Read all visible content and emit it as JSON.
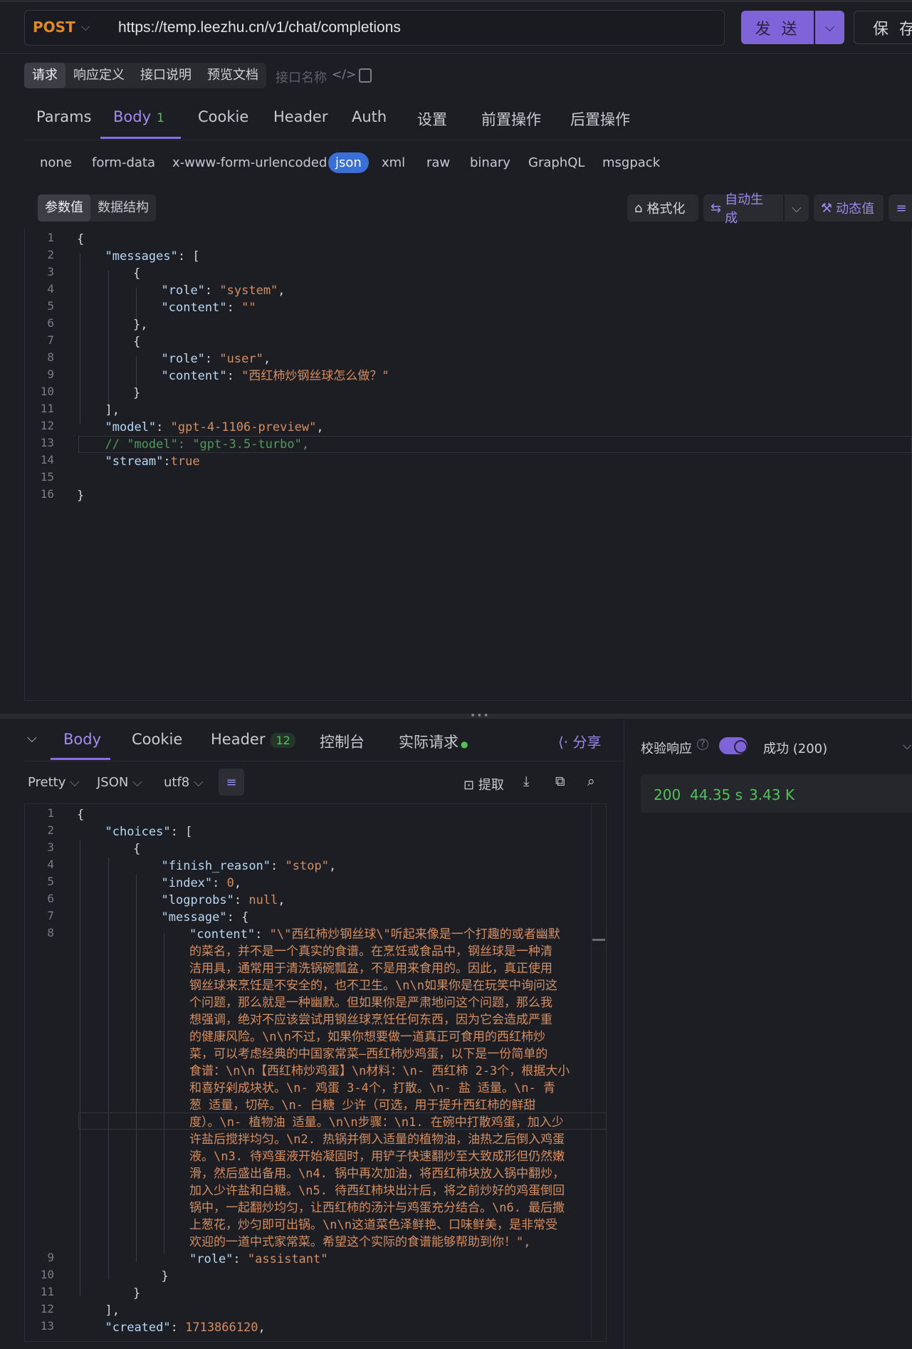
{
  "request": {
    "method": "POST",
    "url": "https://temp.leezhu.cn/v1/chat/completions",
    "send_label": "发 送",
    "save_label": "保 存"
  },
  "top_tabs": [
    "请求",
    "响应定义",
    "接口说明",
    "预览文档"
  ],
  "interface_name_placeholder": "接口名称",
  "req_tabs": {
    "params": "Params",
    "body": "Body",
    "body_count": "1",
    "cookie": "Cookie",
    "header": "Header",
    "auth": "Auth",
    "settings": "设置",
    "pre_ops": "前置操作",
    "post_ops": "后置操作"
  },
  "body_types": [
    "none",
    "form-data",
    "x-www-form-urlencoded",
    "json",
    "xml",
    "raw",
    "binary",
    "GraphQL",
    "msgpack"
  ],
  "editor_tabs": [
    "参数值",
    "数据结构"
  ],
  "editor_tools": {
    "format": "格式化",
    "auto_gen": "自动生成",
    "dynamic": "动态值"
  },
  "request_code": [
    {
      "n": "1",
      "t": "{"
    },
    {
      "n": "2",
      "t": "\"messages\": ["
    },
    {
      "n": "3",
      "t": "{"
    },
    {
      "n": "4",
      "k": "\"role\"",
      "v": "\"system\"",
      "tail": ","
    },
    {
      "n": "5",
      "k": "\"content\"",
      "v": "\"\"",
      "tail": ""
    },
    {
      "n": "6",
      "t": "},"
    },
    {
      "n": "7",
      "t": "{"
    },
    {
      "n": "8",
      "k": "\"role\"",
      "v": "\"user\"",
      "tail": ","
    },
    {
      "n": "9",
      "k": "\"content\"",
      "v": "\"西红柿炒钢丝球怎么做？\"",
      "tail": ""
    },
    {
      "n": "10",
      "t": "}"
    },
    {
      "n": "11",
      "t": "],"
    },
    {
      "n": "12",
      "k": "\"model\"",
      "v": "\"gpt-4-1106-preview\"",
      "tail": ","
    },
    {
      "n": "13",
      "comment": "// \"model\": \"gpt-3.5-turbo\","
    },
    {
      "n": "14",
      "k": "\"stream\"",
      "v": "true",
      "tail": ""
    },
    {
      "n": "15",
      "t": ""
    },
    {
      "n": "16",
      "t": "}"
    }
  ],
  "response_tabs": {
    "body": "Body",
    "cookie": "Cookie",
    "header": "Header",
    "header_count": "12",
    "console": "控制台",
    "actual": "实际请求",
    "share": "分享"
  },
  "response_tools": {
    "pretty": "Pretty",
    "format": "JSON",
    "encoding": "utf8",
    "extract": "提取"
  },
  "response_code": {
    "l1": "{",
    "l2_key": "\"choices\"",
    "l2_tail": ": [",
    "l3": "{",
    "l4_key": "\"finish_reason\"",
    "l4_val": "\"stop\"",
    "l5_key": "\"index\"",
    "l5_val": "0",
    "l6_key": "\"logprobs\"",
    "l6_val": "null",
    "l7_key": "\"message\"",
    "l7_tail": ": {",
    "l8_key": "\"content\"",
    "content_lines": [
      "\"\\\"西红柿炒钢丝球\\\"听起来像是一个打趣的或者幽默",
      "的菜名，并不是一个真实的食谱。在烹饪或食品中，钢丝球是一种清",
      "洁用具，通常用于清洗锅碗瓢盆，不是用来食用的。因此，真正使用",
      "钢丝球来烹饪是不安全的，也不卫生。\\n\\n如果你是在玩笑中询问这",
      "个问题，那么就是一种幽默。但如果你是严肃地问这个问题，那么我",
      "想强调，绝对不应该尝试用钢丝球烹饪任何东西，因为它会造成严重",
      "的健康风险。\\n\\n不过，如果你想要做一道真正可食用的西红柿炒",
      "菜，可以考虑经典的中国家常菜—西红柿炒鸡蛋，以下是一份简单的",
      "食谱：\\n\\n【西红柿炒鸡蛋】\\n材料：\\n- 西红柿 2-3个，根据大小",
      "和喜好剁成块状。\\n- 鸡蛋 3-4个，打散。\\n- 盐 适量。\\n- 青",
      "葱 适量，切碎。\\n- 白糖 少许（可选，用于提升西红柿的鲜甜",
      "度）。\\n- 植物油 适量。\\n\\n步骤：\\n1. 在碗中打散鸡蛋，加入少",
      "许盐后搅拌均匀。\\n2. 热锅并倒入适量的植物油，油热之后倒入鸡蛋",
      "液。\\n3. 待鸡蛋液开始凝固时，用铲子快速翻炒至大致成形但仍然嫩",
      "滑，然后盛出备用。\\n4. 锅中再次加油，将西红柿块放入锅中翻炒，",
      "加入少许盐和白糖。\\n5. 待西红柿块出汁后，将之前炒好的鸡蛋倒回",
      "锅中，一起翻炒均匀，让西红柿的汤汁与鸡蛋充分结合。\\n6. 最后撒",
      "上葱花，炒匀即可出锅。\\n\\n这道菜色泽鲜艳、口味鲜美，是非常受",
      "欢迎的一道中式家常菜。希望这个实际的食谱能够帮助到你！\","
    ],
    "l9_key": "\"role\"",
    "l9_val": "\"assistant\"",
    "l10": "}",
    "l11": "}",
    "l12": "],",
    "l13_key": "\"created\"",
    "l13_val": "1713866120",
    "line_numbers": [
      "1",
      "2",
      "3",
      "4",
      "5",
      "6",
      "7",
      "8",
      "9",
      "10",
      "11",
      "12",
      "13"
    ]
  },
  "validation": {
    "label": "校验响应",
    "result": "成功 (200)",
    "status": "200",
    "time": "44.35 s",
    "size": "3.43 K"
  },
  "colors": {
    "accent": "#7f63d8",
    "tab_active": "#a58cf0",
    "success": "#52c15a",
    "method": "#e08a1e",
    "json_chip": "#3a6fd8"
  }
}
